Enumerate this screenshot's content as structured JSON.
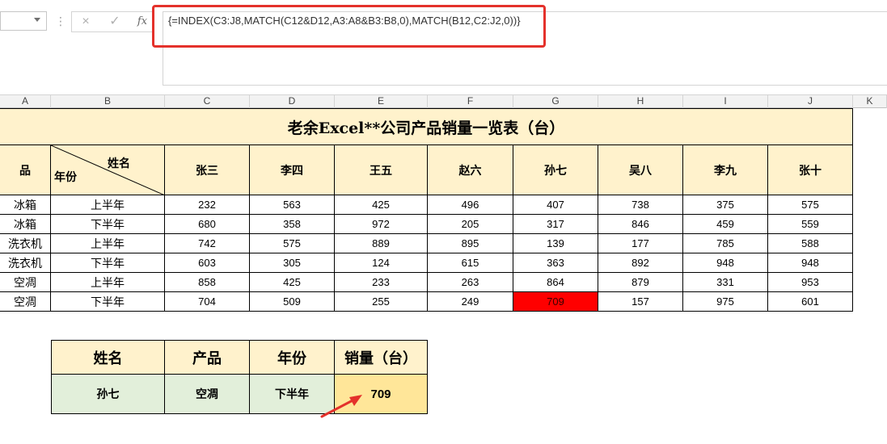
{
  "formula_bar": {
    "cancel_icon": "×",
    "enter_icon": "✓",
    "fx_label": "fx",
    "formula": "{=INDEX(C3:J8,MATCH(C12&D12,A3:A8&B3:B8,0),MATCH(B12,C2:J2,0))}"
  },
  "columns": [
    "A",
    "B",
    "C",
    "D",
    "E",
    "F",
    "G",
    "H",
    "I",
    "J",
    "K"
  ],
  "table": {
    "title": "老余Excel**公司产品销量一览表（台）",
    "corner_product": "品",
    "corner_name": "姓名",
    "corner_year": "年份",
    "names": [
      "张三",
      "李四",
      "王五",
      "赵六",
      "孙七",
      "吴八",
      "李九",
      "张十"
    ],
    "rows": [
      {
        "product": "冰箱",
        "period": "上半年",
        "values": [
          "232",
          "563",
          "425",
          "496",
          "407",
          "738",
          "375",
          "575"
        ]
      },
      {
        "product": "冰箱",
        "period": "下半年",
        "values": [
          "680",
          "358",
          "972",
          "205",
          "317",
          "846",
          "459",
          "559"
        ]
      },
      {
        "product": "洗衣机",
        "period": "上半年",
        "values": [
          "742",
          "575",
          "889",
          "895",
          "139",
          "177",
          "785",
          "588"
        ]
      },
      {
        "product": "洗衣机",
        "period": "下半年",
        "values": [
          "603",
          "305",
          "124",
          "615",
          "363",
          "892",
          "948",
          "948"
        ]
      },
      {
        "product": "空凋",
        "period": "上半年",
        "values": [
          "858",
          "425",
          "233",
          "263",
          "864",
          "879",
          "331",
          "953"
        ]
      },
      {
        "product": "空凋",
        "period": "下半年",
        "values": [
          "704",
          "509",
          "255",
          "249",
          "709",
          "157",
          "975",
          "601"
        ]
      }
    ],
    "highlight_color": "#ff0000"
  },
  "lookup": {
    "headers": [
      "姓名",
      "产品",
      "年份",
      "销量（台）"
    ],
    "values": [
      "孙七",
      "空凋",
      "下半年",
      "709"
    ],
    "header_color": "#fff2cc",
    "input_color": "#e2efda",
    "result_color": "#ffe699",
    "arrow_color": "#e4312b"
  }
}
